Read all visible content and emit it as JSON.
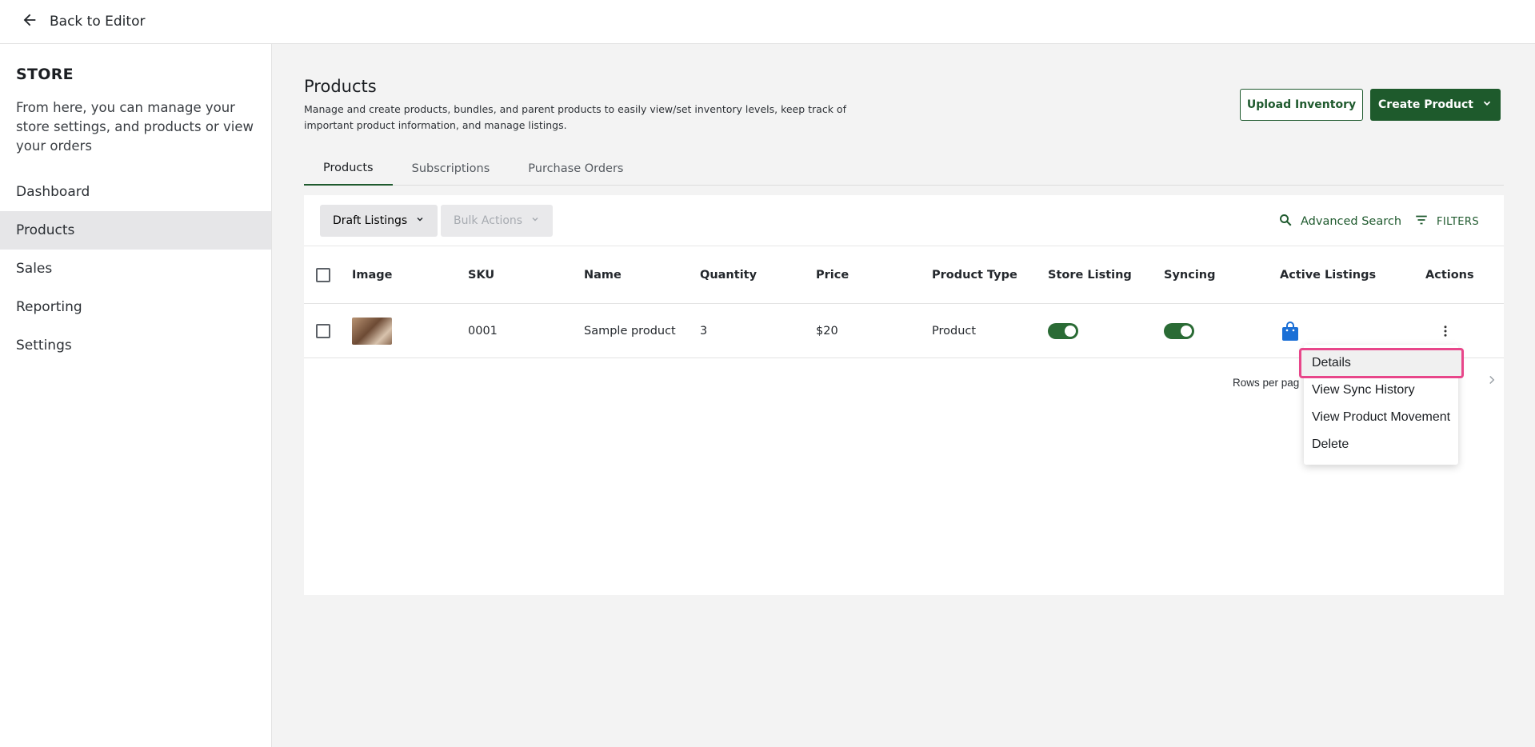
{
  "topbar": {
    "back_label": "Back to Editor"
  },
  "sidebar": {
    "title": "STORE",
    "description": "From here, you can manage your store settings, and products or view your orders",
    "items": [
      {
        "label": "Dashboard"
      },
      {
        "label": "Products"
      },
      {
        "label": "Sales"
      },
      {
        "label": "Reporting"
      },
      {
        "label": "Settings"
      }
    ]
  },
  "header": {
    "title": "Products",
    "description": "Manage and create products, bundles, and parent products to easily view/set inventory levels, keep track of important product information, and manage listings.",
    "upload_label": "Upload Inventory",
    "create_label": "Create Product"
  },
  "tabs": [
    {
      "label": "Products"
    },
    {
      "label": "Subscriptions"
    },
    {
      "label": "Purchase Orders"
    }
  ],
  "toolbar": {
    "draft_label": "Draft Listings",
    "bulk_label": "Bulk Actions",
    "advanced_search_label": "Advanced Search",
    "filters_label": "FILTERS"
  },
  "table": {
    "columns": [
      "Image",
      "SKU",
      "Name",
      "Quantity",
      "Price",
      "Product Type",
      "Store Listing",
      "Syncing",
      "Active Listings",
      "Actions"
    ],
    "rows": [
      {
        "sku": "0001",
        "name": "Sample product",
        "quantity": "3",
        "price": "$20",
        "type": "Product"
      }
    ]
  },
  "pagination": {
    "rows_per_page_label": "Rows per pag"
  },
  "menu": {
    "items": [
      {
        "label": "Details"
      },
      {
        "label": "View Sync History"
      },
      {
        "label": "View Product Movement"
      },
      {
        "label": "Delete"
      }
    ]
  },
  "colors": {
    "brand_green": "#1e5a2c",
    "highlight": "#e8468a",
    "bag_blue": "#1a6fd6"
  }
}
